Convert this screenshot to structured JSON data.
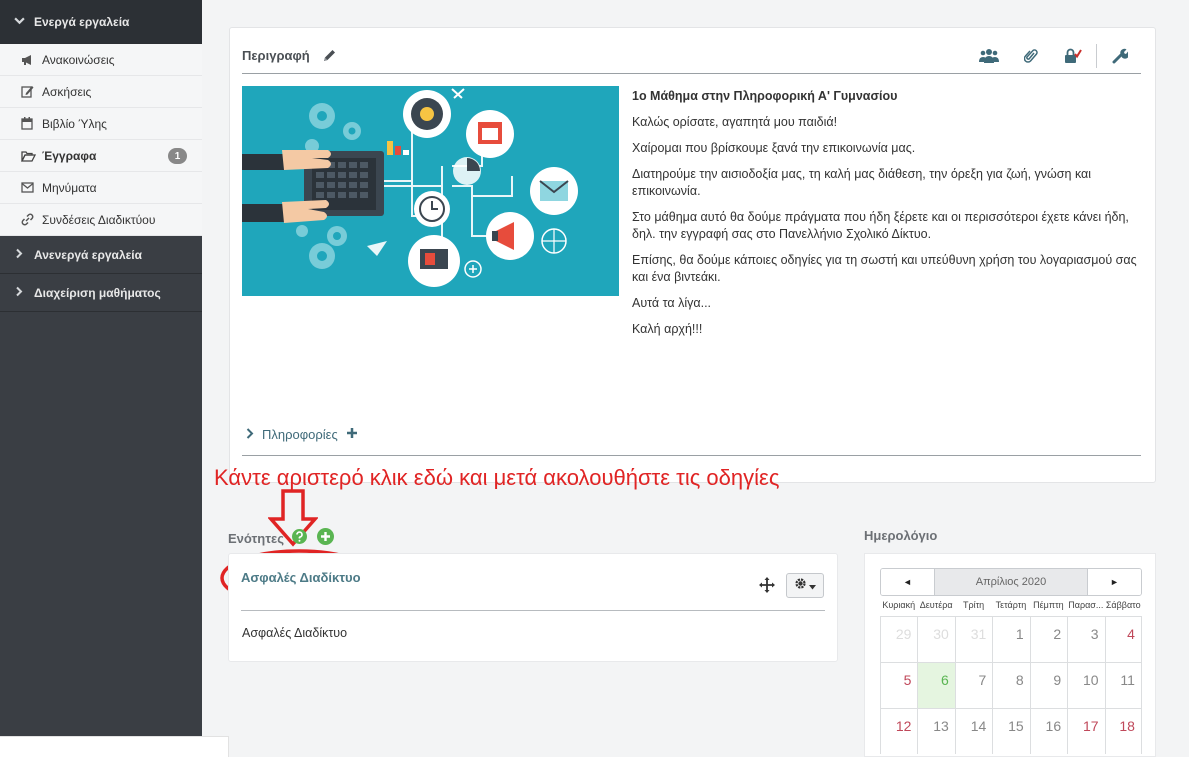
{
  "sidebar": {
    "active_group": "Ενεργά εργαλεία",
    "tools": [
      {
        "label": "Ανακοινώσεις",
        "icon": "megaphone-icon"
      },
      {
        "label": "Ασκήσεις",
        "icon": "edit-icon"
      },
      {
        "label": "Βιβλίο Ύλης",
        "icon": "calendar-icon"
      },
      {
        "label": "Έγγραφα",
        "icon": "folder-open-icon",
        "badge": "1"
      },
      {
        "label": "Μηνύματα",
        "icon": "envelope-icon"
      },
      {
        "label": "Συνδέσεις Διαδικτύου",
        "icon": "link-icon"
      }
    ],
    "inactive_group": "Ανενεργά εργαλεία",
    "admin_group": "Διαχείριση μαθήματος"
  },
  "description": {
    "title": "Περιγραφή",
    "heading": "1ο Μάθημα στην Πληροφορική Α' Γυμνασίου",
    "paragraphs": [
      "Καλώς ορίσατε, αγαπητά μου παιδιά!",
      "Χαίρομαι που βρίσκουμε ξανά την επικοινωνία μας.",
      "Διατηρούμε την αισιοδοξία μας, τη καλή μας διάθεση, την όρεξη για ζωή, γνώση και επικοινωνία.",
      "Στο μάθημα αυτό θα δούμε πράγματα που ήδη ξέρετε και οι περισσότεροι έχετε κάνει ήδη, δηλ. την εγγραφή σας στο Πανελλήνιο Σχολικό Δίκτυο.",
      "Επίσης, θα δούμε κάποιες οδηγίες για τη σωστή και υπεύθυνη χρήση του λογαριασμού σας και ένα βιντεάκι.",
      "Αυτά τα λίγα...",
      "Καλή αρχή!!!"
    ],
    "info_label": "Πληροφορίες"
  },
  "annotation": {
    "text": "Κάντε αριστερό κλικ εδώ και μετά ακολουθήστε τις οδηγίες"
  },
  "sections": {
    "heading": "Ενότητες",
    "item_title": "Ασφαλές Διαδίκτυο",
    "item_body": "Ασφαλές Διαδίκτυο"
  },
  "calendar": {
    "heading": "Ημερολόγιο",
    "month": "Απρίλιος 2020",
    "prev": "◄",
    "next": "►",
    "weekdays": [
      "Κυριακή",
      "Δευτέρα",
      "Τρίτη",
      "Τετάρτη",
      "Πέμπτη",
      "Παρασ...",
      "Σάββατο"
    ],
    "weeks": [
      [
        "29",
        "30",
        "31",
        "1",
        "2",
        "3",
        "4"
      ],
      [
        "5",
        "6",
        "7",
        "8",
        "9",
        "10",
        "11"
      ],
      [
        "12",
        "13",
        "14",
        "15",
        "16",
        "17",
        "18"
      ]
    ]
  },
  "colors": {
    "sidebar_bg": "#3a3e44",
    "accent_teal": "#3f6a79",
    "annotation_red": "#e02424",
    "image_bg": "#1fa6bb"
  }
}
